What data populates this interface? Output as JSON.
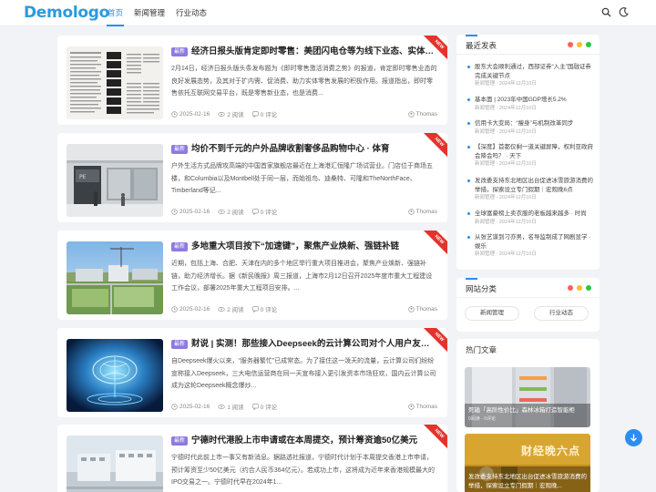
{
  "header": {
    "logo": "Demologo",
    "nav": [
      {
        "label": "首页",
        "active": true
      },
      {
        "label": "新闻管理",
        "active": false
      },
      {
        "label": "行业动态",
        "active": false
      }
    ],
    "icons": [
      "search-icon",
      "theme-toggle-icon"
    ]
  },
  "articles": [
    {
      "badge": "最新",
      "title": "经济日报头版肯定即时零售：美团闪电仓等为线下业态、实体门店...",
      "excerpt": "2月14日，经济日报头版头条发布题为《即时零售激活消费之势》的报道，肯定即时零售业态的良好发展态势，及其对于扩内需、促消费、助力实体零售发展的积极作用。报道指出，即时零售依托互联网交易平台，既是零售新业态，也是消费...",
      "date": "2025-02-16",
      "views": "2 阅读",
      "comments": "0 评论",
      "author": "Thomas",
      "ribbon": "NEW"
    },
    {
      "badge": "最新",
      "title": "均价不到千元的户外品牌收割奢侈品购物中心 · 体育",
      "excerpt": "户外生活方式品牌攻高端的中国首家旗舰店最近在上海港汇恒隆广场试营业。门店位于商场五楼，和Columbia以及Montbell处于同一层，而始祖鸟、迪桑特、可隆和TheNorthFace、Timberland等记...",
      "date": "2025-02-16",
      "views": "2 阅读",
      "comments": "0 评论",
      "author": "Thomas",
      "ribbon": "NEW"
    },
    {
      "badge": "最新",
      "title": "多地重大项目按下“加速键”，聚焦产业焕新、强链补链",
      "excerpt": "近期，包括上海、合肥、天津在内的多个地区举行重大项目推进会，聚焦产业焕新、强链补链，助力经济增长。据《新民晚报》周三报道，上海市2月12日召开2025年度市重大工程建设工作会议，部署2025年重大工程项目安排。...",
      "date": "2025-02-16",
      "views": "2 阅读",
      "comments": "0 评论",
      "author": "Thomas",
      "ribbon": "NEW"
    },
    {
      "badge": "最新",
      "title": "财说 | 实测！那些接入Deepseek的云计算公司对个人用户友好吗...",
      "excerpt": "自Deepseek爆火以来，“服务器繁忙”已成常态。为了接住这一泼天的流量，云计算公司们纷纷宣称接入Deepseek，三大电信运营商在同一天宣布接入更引发资本市场狂欢，国内云计算公司成为这轮Deepseek概念爆炒...",
      "date": "2025-02-16",
      "views": "1 阅读",
      "comments": "0 评论",
      "author": "Thomas",
      "ribbon": "NEW"
    },
    {
      "badge": "最新",
      "title": "宁德时代港股上市申请或在本周提交，预计筹资逾50亿美元",
      "excerpt": "宁德时代此前上市一事又有新消息。据路透社报道，宁德时代计划于本周提交香港上市申请，预计筹资至少50亿美元（约合人民币364亿元）。若成功上市，这将成为近年来香港规模最大的IPO交易之一。宁德时代早在2024年1...",
      "date": "2025-02-16",
      "views": "1 阅读",
      "comments": "0 评论",
      "author": "Thomas",
      "ribbon": "NEW"
    }
  ],
  "sidebar": {
    "latest": {
      "title": "最近发表",
      "items": [
        {
          "title": "股东大会顺利通过，西部证券“入主”国融证券完成关键节点",
          "date": "2024年12月10日"
        },
        {
          "title": "基本面 | 2023年中国GDP增长5.2%",
          "date": "2024年12月10日"
        },
        {
          "title": "信用卡大变局：“瘦身”与机制改革同步",
          "date": "2024年12月10日"
        },
        {
          "title": "【深度】首都仅剩一道关键屏障，权利亚政府会降会吗？ · 天下",
          "date": "2024年12月10日"
        },
        {
          "title": "发改委支持东北地区出台促进冰雪旅游消费的举措，探索设立专门假期｜宏观晚6点",
          "date": "2024年12月10日"
        },
        {
          "title": "全球富豪榜上卖衣服的老板越来越多 · 时尚",
          "date": "2024年12月10日"
        },
        {
          "title": "从张艺谋到刁亦男，名导监制成了网剧显学 · 娱乐",
          "date": "2024年12月10日"
        }
      ]
    },
    "categories": {
      "title": "网站分类",
      "tags": [
        "新闻管理",
        "行业动态"
      ]
    },
    "hot": {
      "title": "热门文章",
      "items": [
        {
          "title": "死磕「高阶性价比」森林冰箱打造智能柜",
          "meta": "0阅读 · 0评论"
        },
        {
          "title": "发改委支持东北地区出台促进冰雪旅游消费的举措，探索设立专门假期｜宏观晚...",
          "overlay": "财经晚六点"
        }
      ]
    }
  },
  "colors": {
    "accent": "#2d8cf0",
    "badge": "#8d7ae0",
    "ribbon": "#e2342c",
    "dot_red": "#ff5f57",
    "dot_yellow": "#febc2e",
    "dot_green": "#28c840"
  }
}
